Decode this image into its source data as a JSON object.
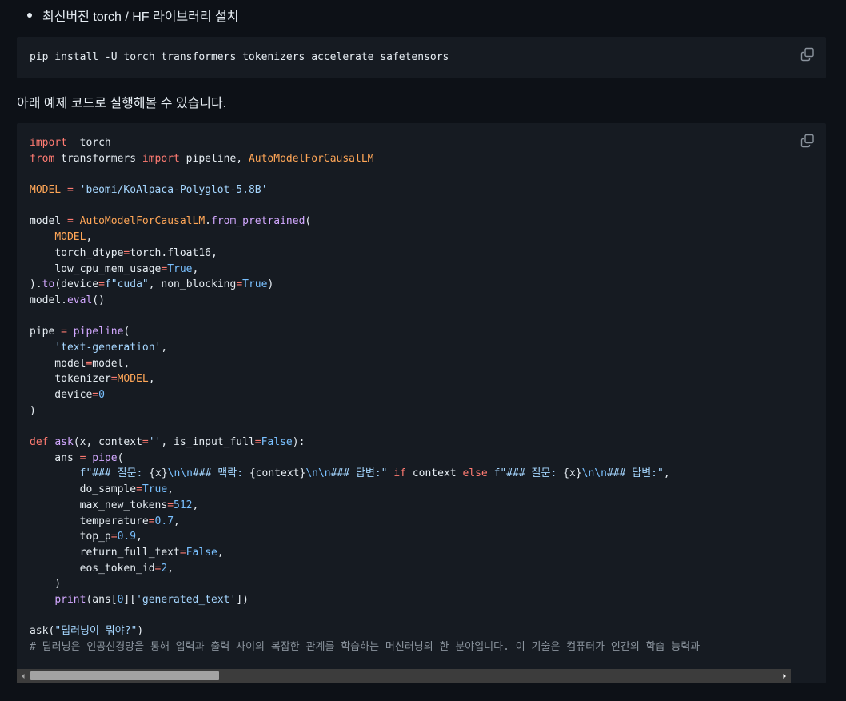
{
  "bullet": {
    "text": "최신버전 torch / HF 라이브러리 설치"
  },
  "install_block": {
    "code": "pip install -U torch transformers tokenizers accelerate safetensors",
    "copy_icon": "copy-icon"
  },
  "prose": {
    "text": "아래 예제 코드로 실행해볼 수 있습니다."
  },
  "example_block": {
    "copy_icon": "copy-icon",
    "code_lines": [
      [
        [
          "kw",
          "import"
        ],
        [
          "",
          "  torch"
        ]
      ],
      [
        [
          "kw",
          "from"
        ],
        [
          "",
          " transformers "
        ],
        [
          "kw",
          "import"
        ],
        [
          "",
          " pipeline, "
        ],
        [
          "cls",
          "AutoModelForCausalLM"
        ]
      ],
      [],
      [
        [
          "cls",
          "MODEL"
        ],
        [
          "",
          " "
        ],
        [
          "op",
          "="
        ],
        [
          "",
          " "
        ],
        [
          "str",
          "'beomi/KoAlpaca-Polyglot-5.8B'"
        ]
      ],
      [],
      [
        [
          "",
          "model "
        ],
        [
          "op",
          "="
        ],
        [
          "",
          " "
        ],
        [
          "cls",
          "AutoModelForCausalLM"
        ],
        [
          "",
          "."
        ],
        [
          "fn",
          "from_pretrained"
        ],
        [
          "",
          "("
        ]
      ],
      [
        [
          "",
          "    "
        ],
        [
          "cls",
          "MODEL"
        ],
        [
          "",
          ","
        ]
      ],
      [
        [
          "",
          "    torch_dtype"
        ],
        [
          "op",
          "="
        ],
        [
          "",
          "torch.float16,"
        ]
      ],
      [
        [
          "",
          "    low_cpu_mem_usage"
        ],
        [
          "op",
          "="
        ],
        [
          "con",
          "True"
        ],
        [
          "",
          ","
        ]
      ],
      [
        [
          "",
          ")."
        ],
        [
          "fn",
          "to"
        ],
        [
          "",
          "(device"
        ],
        [
          "op",
          "="
        ],
        [
          "str",
          "f\"cuda\""
        ],
        [
          "",
          ", non_blocking"
        ],
        [
          "op",
          "="
        ],
        [
          "con",
          "True"
        ],
        [
          "",
          ")"
        ]
      ],
      [
        [
          "",
          "model."
        ],
        [
          "fn",
          "eval"
        ],
        [
          "",
          "()"
        ]
      ],
      [],
      [
        [
          "",
          "pipe "
        ],
        [
          "op",
          "="
        ],
        [
          "",
          " "
        ],
        [
          "fn",
          "pipeline"
        ],
        [
          "",
          "("
        ]
      ],
      [
        [
          "",
          "    "
        ],
        [
          "str",
          "'text-generation'"
        ],
        [
          "",
          ","
        ]
      ],
      [
        [
          "",
          "    model"
        ],
        [
          "op",
          "="
        ],
        [
          "",
          "model,"
        ]
      ],
      [
        [
          "",
          "    tokenizer"
        ],
        [
          "op",
          "="
        ],
        [
          "cls",
          "MODEL"
        ],
        [
          "",
          ","
        ]
      ],
      [
        [
          "",
          "    device"
        ],
        [
          "op",
          "="
        ],
        [
          "num",
          "0"
        ]
      ],
      [
        [
          "",
          ")"
        ]
      ],
      [],
      [
        [
          "kw",
          "def"
        ],
        [
          "",
          " "
        ],
        [
          "fn",
          "ask"
        ],
        [
          "",
          "(x, context"
        ],
        [
          "op",
          "="
        ],
        [
          "str",
          "''"
        ],
        [
          "",
          ", is_input_full"
        ],
        [
          "op",
          "="
        ],
        [
          "con",
          "False"
        ],
        [
          "",
          "):"
        ]
      ],
      [
        [
          "",
          "    ans "
        ],
        [
          "op",
          "="
        ],
        [
          "",
          " "
        ],
        [
          "fn",
          "pipe"
        ],
        [
          "",
          "("
        ]
      ],
      [
        [
          "",
          "        "
        ],
        [
          "str",
          "f\"### 질문: "
        ],
        [
          "",
          "{x}"
        ],
        [
          "num",
          "\\n\\n"
        ],
        [
          "str",
          "### 맥락: "
        ],
        [
          "",
          "{context}"
        ],
        [
          "num",
          "\\n\\n"
        ],
        [
          "str",
          "### 답변:\""
        ],
        [
          "",
          " "
        ],
        [
          "kw",
          "if"
        ],
        [
          "",
          " context "
        ],
        [
          "kw",
          "else"
        ],
        [
          "",
          " "
        ],
        [
          "str",
          "f\"### 질문: "
        ],
        [
          "",
          "{x}"
        ],
        [
          "num",
          "\\n\\n"
        ],
        [
          "str",
          "### 답변:\""
        ],
        [
          "",
          ","
        ]
      ],
      [
        [
          "",
          "        do_sample"
        ],
        [
          "op",
          "="
        ],
        [
          "con",
          "True"
        ],
        [
          "",
          ","
        ]
      ],
      [
        [
          "",
          "        max_new_tokens"
        ],
        [
          "op",
          "="
        ],
        [
          "num",
          "512"
        ],
        [
          "",
          ","
        ]
      ],
      [
        [
          "",
          "        temperature"
        ],
        [
          "op",
          "="
        ],
        [
          "num",
          "0.7"
        ],
        [
          "",
          ","
        ]
      ],
      [
        [
          "",
          "        top_p"
        ],
        [
          "op",
          "="
        ],
        [
          "num",
          "0.9"
        ],
        [
          "",
          ","
        ]
      ],
      [
        [
          "",
          "        return_full_text"
        ],
        [
          "op",
          "="
        ],
        [
          "con",
          "False"
        ],
        [
          "",
          ","
        ]
      ],
      [
        [
          "",
          "        eos_token_id"
        ],
        [
          "op",
          "="
        ],
        [
          "num",
          "2"
        ],
        [
          "",
          ","
        ]
      ],
      [
        [
          "",
          "    )"
        ]
      ],
      [
        [
          "",
          "    "
        ],
        [
          "fn",
          "print"
        ],
        [
          "",
          "(ans["
        ],
        [
          "num",
          "0"
        ],
        [
          "",
          "]["
        ],
        [
          "str",
          "'generated_text'"
        ],
        [
          "",
          "])"
        ]
      ],
      [],
      [
        [
          "",
          "ask("
        ],
        [
          "str",
          "\"딥러닝이 뭐야?\""
        ],
        [
          "",
          ")"
        ]
      ],
      [
        [
          "cmt",
          "# 딥러닝은 인공신경망을 통해 입력과 출력 사이의 복잡한 관계를 학습하는 머신러닝의 한 분야입니다. 이 기술은 컴퓨터가 인간의 학습 능력과"
        ]
      ]
    ]
  },
  "scrollbar": {
    "left_icon": "scroll-left-arrow-icon",
    "right_icon": "scroll-right-arrow-icon"
  }
}
